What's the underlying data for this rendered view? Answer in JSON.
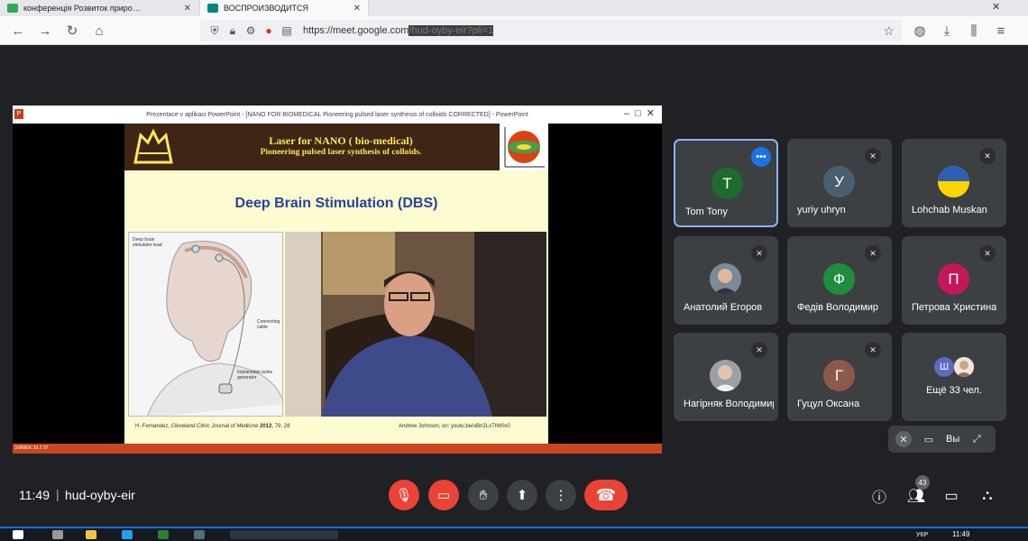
{
  "browser": {
    "tabs": [
      {
        "title": "конференція Розвиток приро…",
        "favicon_color": "#34a853"
      },
      {
        "title": "ВОСПРОИЗВОДИТСЯ",
        "favicon_color": "#00897b"
      }
    ],
    "url_host": "https://meet.google.com",
    "url_path": "/hud-oyby-eir?pli=1"
  },
  "presentation": {
    "window_title": "Prezentace v aplikaci PowerPoint - [NANO FOR BIOMEDICAL Pioneering pulsed laser synthesis of colloids CORRECTED] - PowerPoint",
    "slide": {
      "header_line1": "Laser for NANO ( bio-medical)",
      "header_line2": "Pioneering pulsed laser synthesis of colloids.",
      "title": "Deep Brain Stimulation (DBS)",
      "labels": {
        "lead": "Deep brain stimulator lead",
        "cable": "Connecting cable",
        "generator": "Implantable pulse generator"
      },
      "citation_author": "H. Fernandez, ",
      "citation_journal": "Cleveland Clinic Journal of Medicine ",
      "citation_year": "2012",
      "citation_pages": ", 79, 28",
      "video_credit": "Andrew Johnson, on: youtu.be/uBn2LxTtW0s0"
    },
    "status_text": "SNÍMEK 39 Z 97"
  },
  "participants": [
    {
      "name": "Tom Tony",
      "initial": "T",
      "color": "#1e6b2f",
      "active": true,
      "muted": false
    },
    {
      "name": "yuriy uhryn",
      "initial": "У",
      "color": "#4a5f6e",
      "active": false,
      "muted": true
    },
    {
      "name": "Lohchab Muskan",
      "initial": "",
      "color": "#ffd500",
      "active": false,
      "muted": true
    },
    {
      "name": "Анатолий Егоров",
      "initial": "",
      "color": "#6b7280",
      "active": false,
      "muted": true
    },
    {
      "name": "Федів Володимир",
      "initial": "Ф",
      "color": "#1e8e3e",
      "active": false,
      "muted": true
    },
    {
      "name": "Петрова Христина",
      "initial": "П",
      "color": "#c2185b",
      "active": false,
      "muted": true
    },
    {
      "name": "Нагірняк Володимир",
      "initial": "",
      "color": "#8a8a8a",
      "active": false,
      "muted": true
    },
    {
      "name": "Гуцул Оксана",
      "initial": "Г",
      "color": "#8d5a4a",
      "active": false,
      "muted": true
    }
  ],
  "more_tile": {
    "initial": "Ш",
    "label": "Ещё 33 чел.",
    "color": "#5c6bc0"
  },
  "self_view": {
    "name": "Вы"
  },
  "meeting": {
    "time": "11:49",
    "code": "hud-oyby-eir",
    "participant_count": "43"
  },
  "taskbar": {
    "lang": "УКР",
    "time": "11:49"
  }
}
